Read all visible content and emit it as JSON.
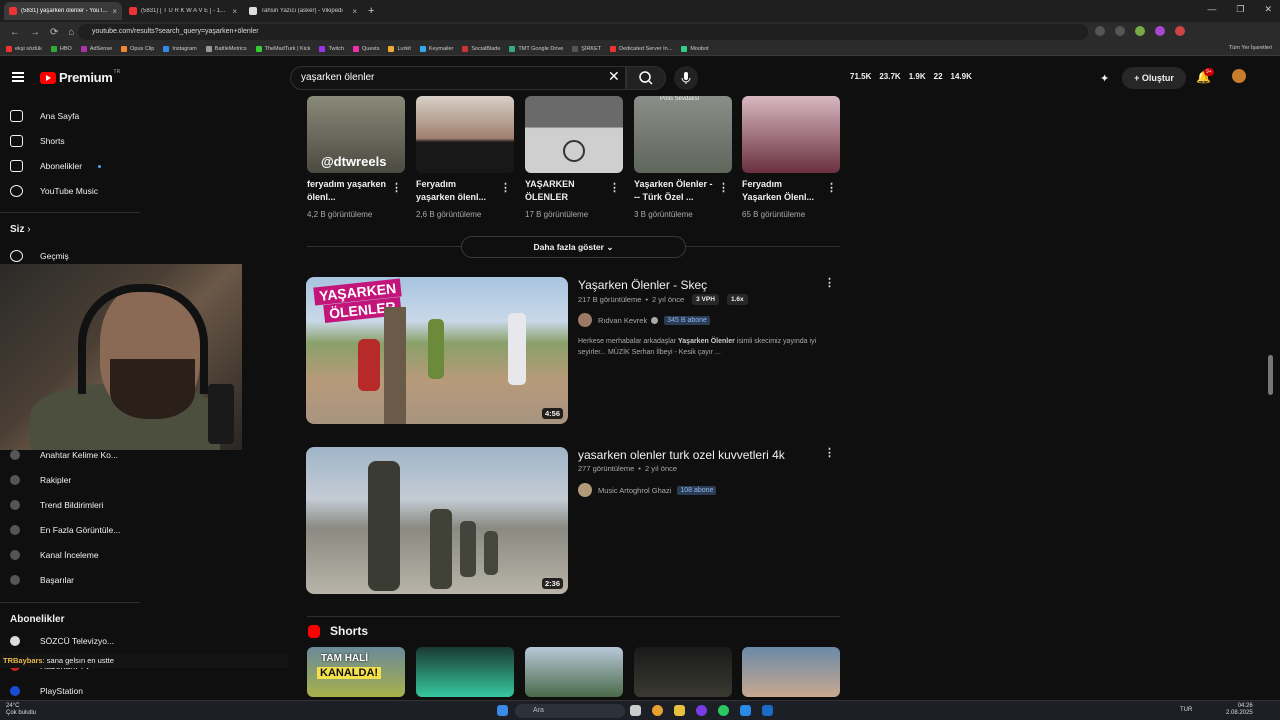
{
  "browser": {
    "tabs": [
      {
        "title": "(5831) yaşarken ölenler - YouT...",
        "active": true,
        "color": "#e33"
      },
      {
        "title": "(5831) [ T U R K W A V E ] - 1...",
        "active": false,
        "color": "#e33"
      },
      {
        "title": "Tahsin Yazıcı (asker) - Vikipedi",
        "active": false,
        "color": "#ddd"
      }
    ],
    "url": "youtube.com/results?search_query=yaşarken+ölenler",
    "bookmarks": [
      "ekşi sözlük",
      "HBO",
      "AdSense",
      "Opus Clip",
      "Instagram",
      "BattleMetrics",
      "TheMadTurk | Kick",
      "Twitch",
      "Quests",
      "Lurkit",
      "Keymailer",
      "SocialBlade",
      "TMT Google Drive",
      "ŞİRKET",
      "Dedicated Server In...",
      "Moobot"
    ],
    "bookmarks_other": "Tüm Yer İşaretleri"
  },
  "youtube": {
    "logo": "Premium",
    "logo_sup": "TR",
    "search_query": "yaşarken ölenler",
    "stats": [
      "71.5K",
      "23.7K",
      "1.9K",
      "22",
      "14.9K"
    ],
    "create_label": "Oluştur",
    "notif_badge": "9+"
  },
  "sidebar": {
    "top": [
      "Ana Sayfa",
      "Shorts",
      "Abonelikler",
      "YouTube Music"
    ],
    "you_label": "Siz",
    "history": "Geçmiş",
    "tools": [
      "Anahtar Kelime Ko...",
      "Rakipler",
      "Trend Bildirimleri",
      "En Fazla Görüntüle...",
      "Kanal İnceleme",
      "Başarılar"
    ],
    "subs_title": "Abonelikler",
    "subs": [
      "SÖZCÜ Televizyo...",
      "Haberturk TV",
      "PlayStation"
    ]
  },
  "shorts_row1": [
    {
      "title": "feryadım yaşarken ölenl...",
      "views": "4,2 B görüntüleme",
      "overlay": "@dtwreels"
    },
    {
      "title": "Feryadım yaşarken ölenl...",
      "views": "2,6 B görüntüleme"
    },
    {
      "title": "YAŞARKEN ÖLENLER",
      "views": "17 B görüntüleme"
    },
    {
      "title": "Yaşarken Ölenler --- Türk Özel ...",
      "views": "3 B görüntüleme",
      "overlay": "Polis Sevdalısı"
    },
    {
      "title": "Feryadım Yaşarken Ölenl...",
      "views": "65 B görüntüleme"
    }
  ],
  "more_label": "Daha fazla göster",
  "videos": [
    {
      "title": "Yaşarken Ölenler - Skeç",
      "views": "217 B görüntüleme",
      "age": "2 yıl önce",
      "chip1": "3 VPH",
      "chip2": "1.6x",
      "channel": "Rıdvan Kevrek",
      "subs": "345 B abone",
      "desc_a": "Herkese merhabalar arkadaşlar ",
      "desc_b": "Yaşarken Ölenler",
      "desc_c": " isimli skecimiz yayında iyi seyirler... MÜZİK Serhan İlbeyi - Kesik çayır ...",
      "duration": "4:56",
      "thumb_text1": "YAŞARKEN",
      "thumb_text2": "ÖLENLER"
    },
    {
      "title": "yasarken olenler turk ozel kuvvetleri 4k",
      "views": "277 görüntüleme",
      "age": "2 yıl önce",
      "channel": "Music Artoghrol Ghazi",
      "subs": "108 abone",
      "duration": "2:36"
    }
  ],
  "shorts_section": {
    "title": "Shorts",
    "first_overlay1": "TAM HALİ",
    "first_overlay2": "KANALDA!"
  },
  "chat": {
    "user": "TRBaybars",
    "message": ": sana gelsın en ustte"
  },
  "taskbar": {
    "temp": "24°C",
    "weather": "Çok bulutlu",
    "search": "Ara",
    "lang": "TUR",
    "time": "04:26",
    "date": "2.08.2025"
  }
}
